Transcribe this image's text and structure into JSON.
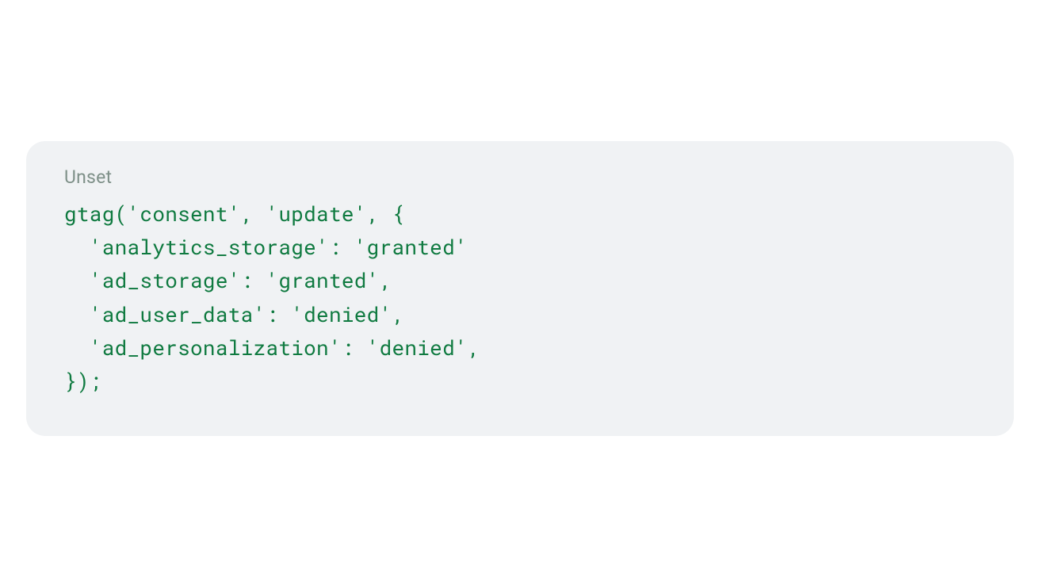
{
  "codeBlock": {
    "label": "Unset",
    "code": "gtag('consent', 'update', {\n  'analytics_storage': 'granted'\n  'ad_storage': 'granted',\n  'ad_user_data': 'denied',\n  'ad_personalization': 'denied',\n});"
  }
}
